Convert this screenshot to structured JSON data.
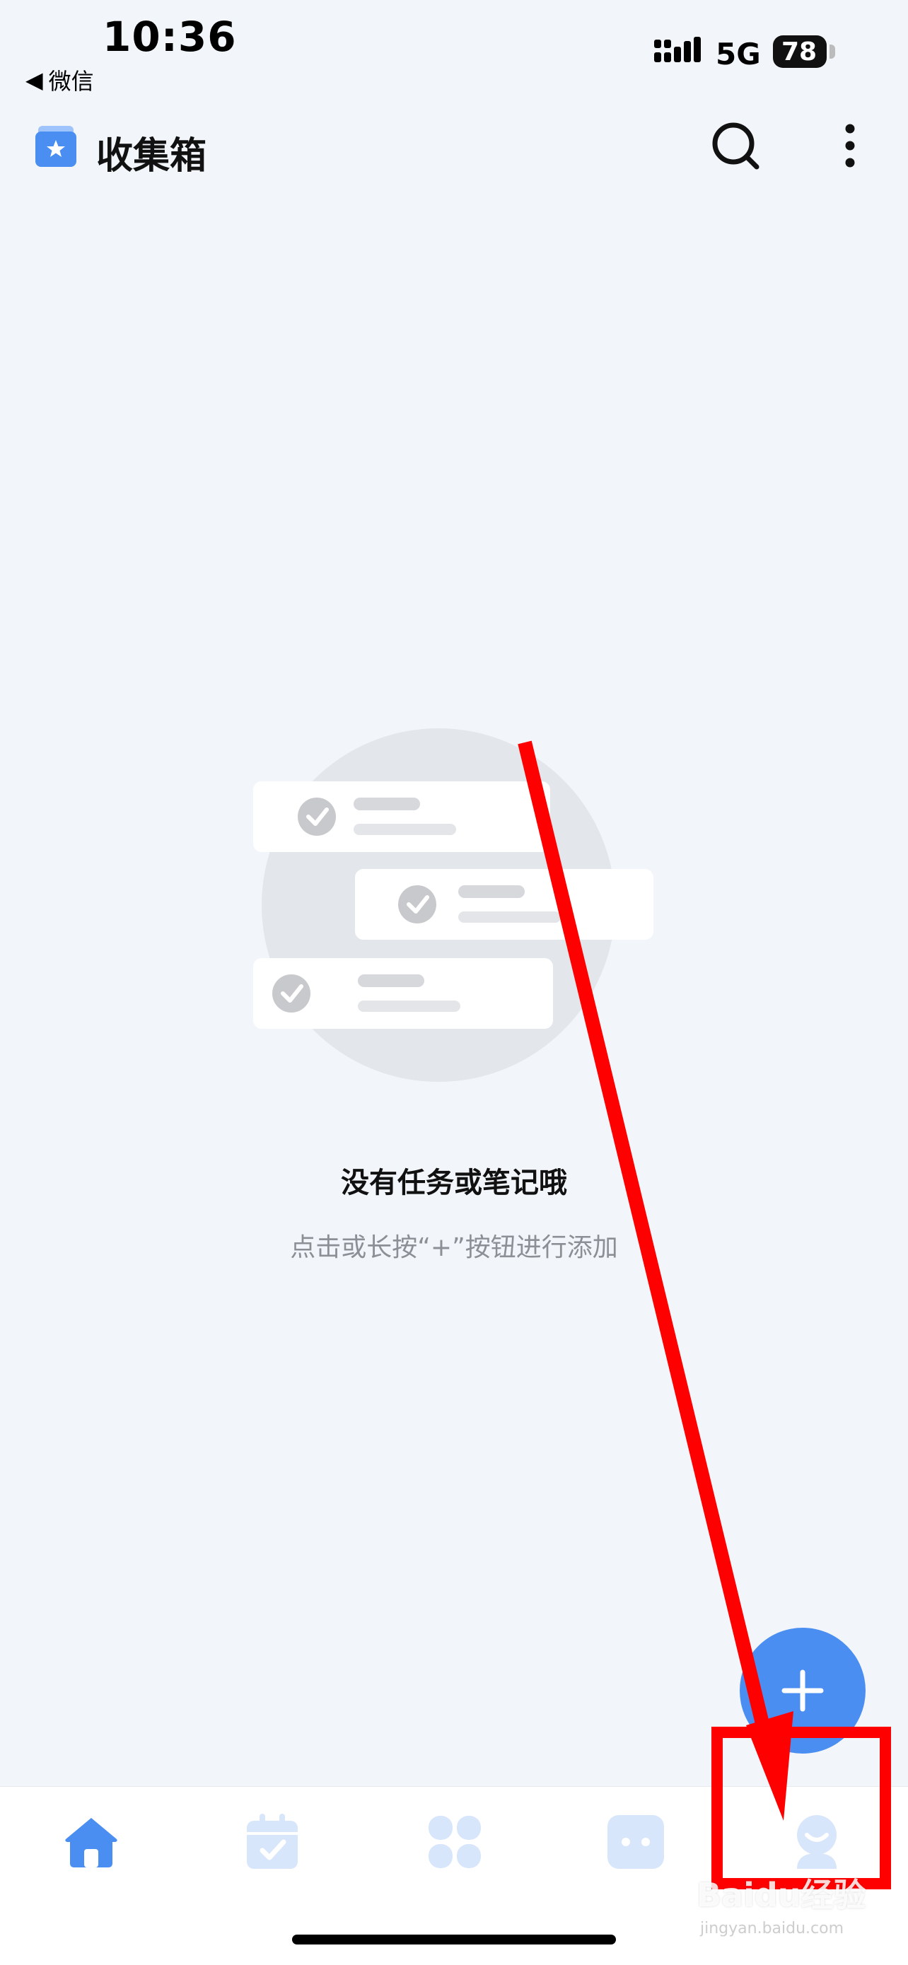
{
  "status_bar": {
    "time": "10:36",
    "back_app": "微信",
    "network": "5G",
    "battery": "78"
  },
  "header": {
    "title": "收集箱",
    "icons": [
      "inbox-icon",
      "search-icon",
      "more-icon"
    ]
  },
  "empty_state": {
    "title": "没有任务或笔记哦",
    "hint": "点击或长按“+”按钮进行添加"
  },
  "fab": {
    "icon": "plus-icon"
  },
  "tab_bar": {
    "tabs": [
      {
        "name": "home",
        "icon": "home-icon",
        "active": true
      },
      {
        "name": "calendar",
        "icon": "calendar-check-icon",
        "active": false
      },
      {
        "name": "apps",
        "icon": "four-leaf-icon",
        "active": false
      },
      {
        "name": "more",
        "icon": "dots-icon",
        "active": false
      },
      {
        "name": "profile",
        "icon": "profile-icon",
        "active": false
      }
    ]
  },
  "watermark": {
    "brand": "Baidu经验",
    "url": "jingyan.baidu.com"
  },
  "colors": {
    "accent": "#4a8ef2",
    "tab_inactive": "#d8e6fb",
    "annotation": "#ff0000"
  }
}
